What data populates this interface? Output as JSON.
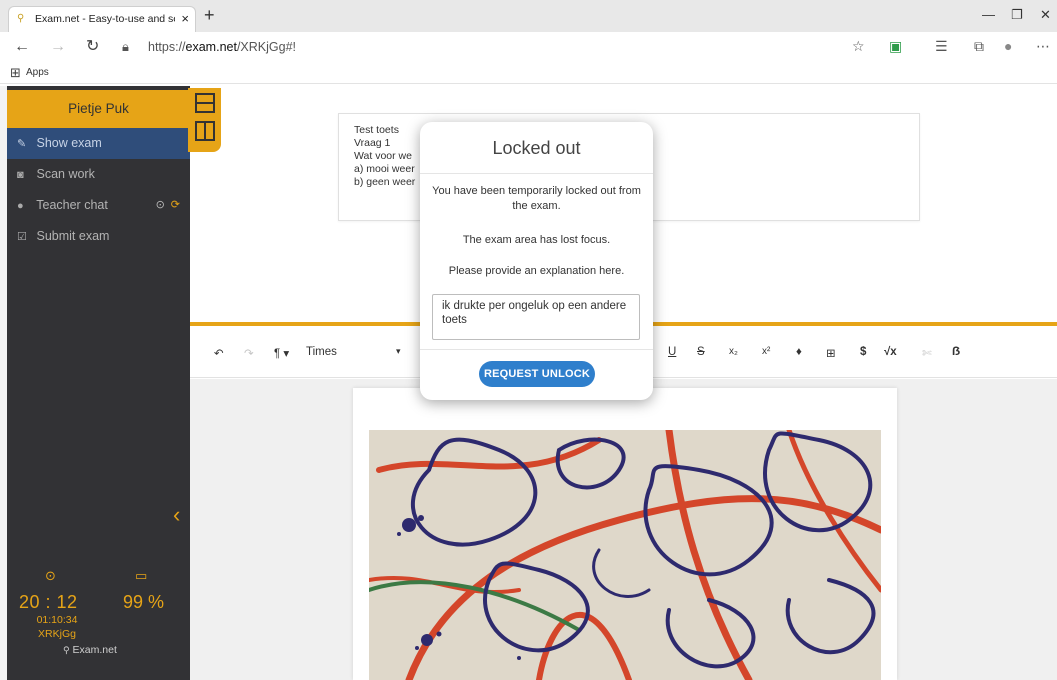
{
  "browser": {
    "tab_title": "Exam.net - Easy-to-use and secu",
    "tab_close": "×",
    "new_tab": "+",
    "url_prefix": "https://",
    "url_host": "exam.net",
    "url_path": "/XRKjGg#!",
    "bookmarks": {
      "apps_label": "Apps"
    }
  },
  "sidebar": {
    "student_name": "Pietje Puk",
    "items": [
      {
        "label": "Show exam",
        "icon": "edit-icon",
        "active": true
      },
      {
        "label": "Scan work",
        "icon": "camera-icon",
        "active": false
      },
      {
        "label": "Teacher chat",
        "icon": "chat-icon",
        "active": false
      },
      {
        "label": "Submit exam",
        "icon": "check-square-icon",
        "active": false
      }
    ],
    "clock": "20 : 12",
    "battery": "99 %",
    "elapsed": "01:10:34",
    "exam_code": "XRKjGg",
    "brand": "Exam.net"
  },
  "question": {
    "lines": [
      "Test toets",
      "Vraag 1",
      "Wat voor we",
      "a) mooi weer",
      "b) geen weer"
    ]
  },
  "editor": {
    "font": "Times"
  },
  "modal": {
    "title": "Locked out",
    "message1": "You have been temporarily locked out from the exam.",
    "message2": "The exam area has lost focus.",
    "message3": "Please provide an explanation here.",
    "reason_value": "ik drukte per ongeluk op een andere toets",
    "button_label": "REQUEST UNLOCK"
  },
  "colors": {
    "accent": "#e6a417",
    "sidebar_bg": "#323235",
    "active_item": "#2f4d7a",
    "button_blue": "#2f7fcc"
  }
}
